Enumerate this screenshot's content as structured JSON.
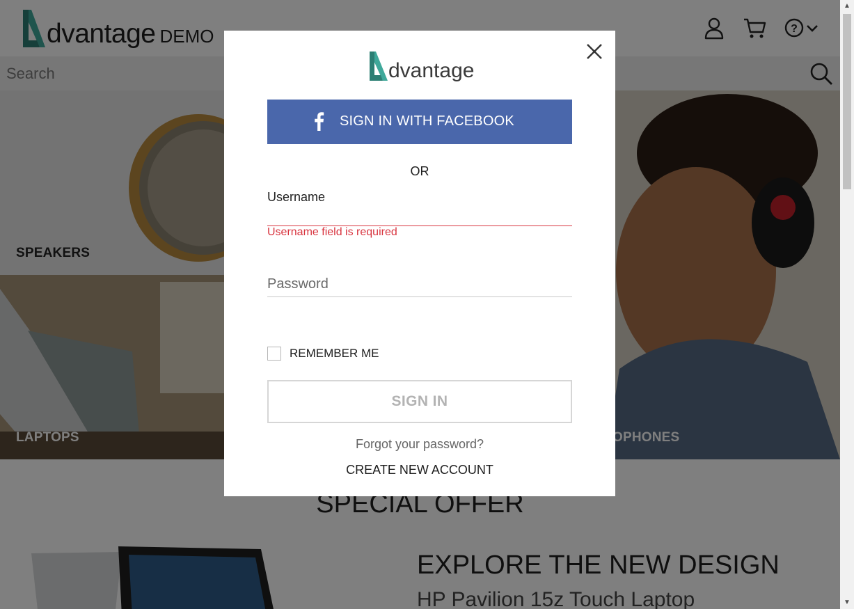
{
  "header": {
    "logo_text": "dvantage",
    "logo_suffix": "DEMO",
    "icons": [
      "user-icon",
      "cart-icon",
      "help-icon",
      "chevron-down-icon"
    ]
  },
  "search": {
    "placeholder": "Search"
  },
  "categories": [
    {
      "label": "SPEAKERS"
    },
    {
      "label": "LAPTOPS"
    },
    {
      "label": "OPHONES"
    }
  ],
  "special": {
    "title": "SPECIAL OFFER",
    "explore": "EXPLORE THE NEW DESIGN",
    "product": "HP Pavilion 15z Touch Laptop"
  },
  "modal": {
    "logo_text": "dvantage",
    "facebook_label": "SIGN IN WITH FACEBOOK",
    "or_text": "OR",
    "username_label": "Username",
    "username_value": "",
    "username_error": "Username field is required",
    "password_placeholder": "Password",
    "remember_label": "REMEMBER ME",
    "signin_label": "SIGN IN",
    "forgot_label": "Forgot your password?",
    "create_label": "CREATE NEW ACCOUNT"
  },
  "colors": {
    "brand_teal": "#3fa89a",
    "facebook_blue": "#4a67ab",
    "error_red": "#d8343f",
    "overlay": "rgba(0,0,0,0.5)"
  }
}
